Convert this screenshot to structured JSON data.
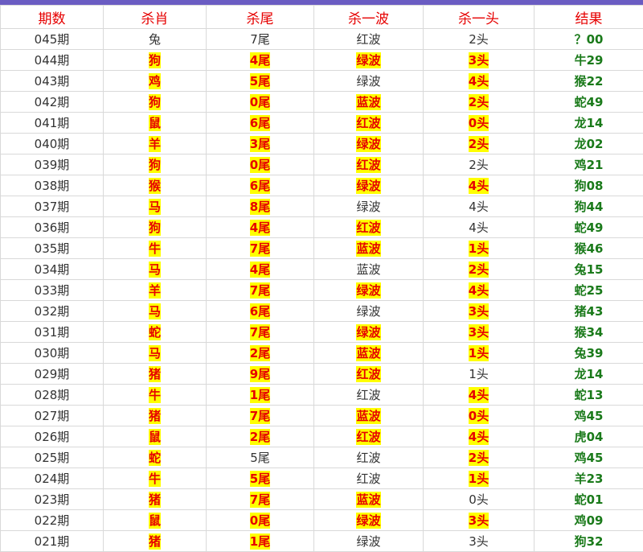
{
  "table": {
    "headers": [
      "期数",
      "杀肖",
      "杀尾",
      "杀一波",
      "杀一头",
      "结果"
    ],
    "rows": [
      {
        "period": "045期",
        "zodiac": "兔",
        "zodiac_hit": false,
        "tail": "7尾",
        "tail_hit": false,
        "wave": "红波",
        "wave_hit": false,
        "head": "2头",
        "head_hit": false,
        "result": "？00"
      },
      {
        "period": "044期",
        "zodiac": "狗",
        "zodiac_hit": true,
        "tail": "4尾",
        "tail_hit": true,
        "wave": "绿波",
        "wave_hit": true,
        "head": "3头",
        "head_hit": true,
        "result": "牛29"
      },
      {
        "period": "043期",
        "zodiac": "鸡",
        "zodiac_hit": true,
        "tail": "5尾",
        "tail_hit": true,
        "wave": "绿波",
        "wave_hit": false,
        "head": "4头",
        "head_hit": true,
        "result": "猴22"
      },
      {
        "period": "042期",
        "zodiac": "狗",
        "zodiac_hit": true,
        "tail": "0尾",
        "tail_hit": true,
        "wave": "蓝波",
        "wave_hit": true,
        "head": "2头",
        "head_hit": true,
        "result": "蛇49"
      },
      {
        "period": "041期",
        "zodiac": "鼠",
        "zodiac_hit": true,
        "tail": "6尾",
        "tail_hit": true,
        "wave": "红波",
        "wave_hit": true,
        "head": "0头",
        "head_hit": true,
        "result": "龙14"
      },
      {
        "period": "040期",
        "zodiac": "羊",
        "zodiac_hit": true,
        "tail": "3尾",
        "tail_hit": true,
        "wave": "绿波",
        "wave_hit": true,
        "head": "2头",
        "head_hit": true,
        "result": "龙02"
      },
      {
        "period": "039期",
        "zodiac": "狗",
        "zodiac_hit": true,
        "tail": "0尾",
        "tail_hit": true,
        "wave": "红波",
        "wave_hit": true,
        "head": "2头",
        "head_hit": false,
        "result": "鸡21"
      },
      {
        "period": "038期",
        "zodiac": "猴",
        "zodiac_hit": true,
        "tail": "6尾",
        "tail_hit": true,
        "wave": "绿波",
        "wave_hit": true,
        "head": "4头",
        "head_hit": true,
        "result": "狗08"
      },
      {
        "period": "037期",
        "zodiac": "马",
        "zodiac_hit": true,
        "tail": "8尾",
        "tail_hit": true,
        "wave": "绿波",
        "wave_hit": false,
        "head": "4头",
        "head_hit": false,
        "result": "狗44"
      },
      {
        "period": "036期",
        "zodiac": "狗",
        "zodiac_hit": true,
        "tail": "4尾",
        "tail_hit": true,
        "wave": "红波",
        "wave_hit": true,
        "head": "4头",
        "head_hit": false,
        "result": "蛇49"
      },
      {
        "period": "035期",
        "zodiac": "牛",
        "zodiac_hit": true,
        "tail": "7尾",
        "tail_hit": true,
        "wave": "蓝波",
        "wave_hit": true,
        "head": "1头",
        "head_hit": true,
        "result": "猴46"
      },
      {
        "period": "034期",
        "zodiac": "马",
        "zodiac_hit": true,
        "tail": "4尾",
        "tail_hit": true,
        "wave": "蓝波",
        "wave_hit": false,
        "head": "2头",
        "head_hit": true,
        "result": "兔15"
      },
      {
        "period": "033期",
        "zodiac": "羊",
        "zodiac_hit": true,
        "tail": "7尾",
        "tail_hit": true,
        "wave": "绿波",
        "wave_hit": true,
        "head": "4头",
        "head_hit": true,
        "result": "蛇25"
      },
      {
        "period": "032期",
        "zodiac": "马",
        "zodiac_hit": true,
        "tail": "6尾",
        "tail_hit": true,
        "wave": "绿波",
        "wave_hit": false,
        "head": "3头",
        "head_hit": true,
        "result": "猪43"
      },
      {
        "period": "031期",
        "zodiac": "蛇",
        "zodiac_hit": true,
        "tail": "7尾",
        "tail_hit": true,
        "wave": "绿波",
        "wave_hit": true,
        "head": "3头",
        "head_hit": true,
        "result": "猴34"
      },
      {
        "period": "030期",
        "zodiac": "马",
        "zodiac_hit": true,
        "tail": "2尾",
        "tail_hit": true,
        "wave": "蓝波",
        "wave_hit": true,
        "head": "1头",
        "head_hit": true,
        "result": "兔39"
      },
      {
        "period": "029期",
        "zodiac": "猪",
        "zodiac_hit": true,
        "tail": "9尾",
        "tail_hit": true,
        "wave": "红波",
        "wave_hit": true,
        "head": "1头",
        "head_hit": false,
        "result": "龙14"
      },
      {
        "period": "028期",
        "zodiac": "牛",
        "zodiac_hit": true,
        "tail": "1尾",
        "tail_hit": true,
        "wave": "红波",
        "wave_hit": false,
        "head": "4头",
        "head_hit": true,
        "result": "蛇13"
      },
      {
        "period": "027期",
        "zodiac": "猪",
        "zodiac_hit": true,
        "tail": "7尾",
        "tail_hit": true,
        "wave": "蓝波",
        "wave_hit": true,
        "head": "0头",
        "head_hit": true,
        "result": "鸡45"
      },
      {
        "period": "026期",
        "zodiac": "鼠",
        "zodiac_hit": true,
        "tail": "2尾",
        "tail_hit": true,
        "wave": "红波",
        "wave_hit": true,
        "head": "4头",
        "head_hit": true,
        "result": "虎04"
      },
      {
        "period": "025期",
        "zodiac": "蛇",
        "zodiac_hit": true,
        "tail": "5尾",
        "tail_hit": false,
        "wave": "红波",
        "wave_hit": false,
        "head": "2头",
        "head_hit": true,
        "result": "鸡45"
      },
      {
        "period": "024期",
        "zodiac": "牛",
        "zodiac_hit": true,
        "tail": "5尾",
        "tail_hit": true,
        "wave": "红波",
        "wave_hit": false,
        "head": "1头",
        "head_hit": true,
        "result": "羊23"
      },
      {
        "period": "023期",
        "zodiac": "猪",
        "zodiac_hit": true,
        "tail": "7尾",
        "tail_hit": true,
        "wave": "蓝波",
        "wave_hit": true,
        "head": "0头",
        "head_hit": false,
        "result": "蛇01"
      },
      {
        "period": "022期",
        "zodiac": "鼠",
        "zodiac_hit": true,
        "tail": "0尾",
        "tail_hit": true,
        "wave": "绿波",
        "wave_hit": true,
        "head": "3头",
        "head_hit": true,
        "result": "鸡09"
      },
      {
        "period": "021期",
        "zodiac": "猪",
        "zodiac_hit": true,
        "tail": "1尾",
        "tail_hit": true,
        "wave": "绿波",
        "wave_hit": false,
        "head": "3头",
        "head_hit": false,
        "result": "狗32"
      }
    ]
  },
  "colors": {
    "header_text": "#e60000",
    "hit_highlight": "#ffff00",
    "hit_text": "#e60000",
    "result_text": "#1a7a1a",
    "top_bar": "#6a5cc2"
  }
}
